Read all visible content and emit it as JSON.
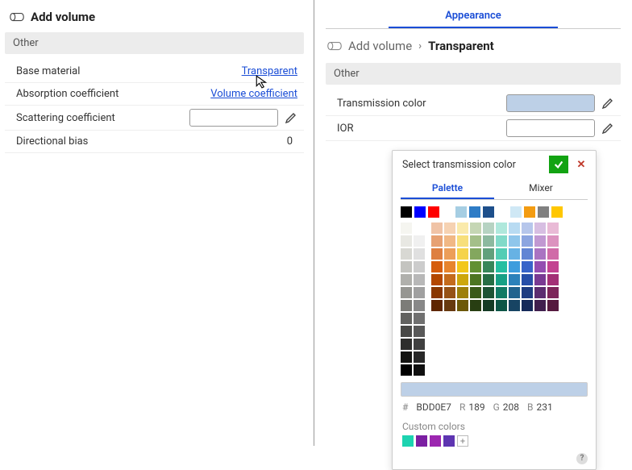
{
  "left": {
    "title": "Add volume",
    "section": "Other",
    "rows": [
      {
        "label": "Base material",
        "value": "Transparent"
      },
      {
        "label": "Absorption coefficient",
        "value": "Volume coefficient"
      },
      {
        "label": "Scattering coefficient",
        "value": ""
      },
      {
        "label": "Directional bias",
        "value": "0"
      }
    ]
  },
  "right": {
    "topTab": "Appearance",
    "breadcrumb": {
      "parent": "Add volume",
      "current": "Transparent"
    },
    "section": "Other",
    "rows": [
      {
        "label": "Transmission color",
        "styleBg": "background:#BDD0E7"
      },
      {
        "label": "IOR",
        "value": ""
      }
    ]
  },
  "popup": {
    "title": "Select transmission color",
    "closeGlyph": "✕",
    "tabs": [
      "Palette",
      "Mixer"
    ],
    "accentSwatches": [
      "#000000",
      "#0000ff",
      "#ff0000",
      "transparent",
      "#a6cee3",
      "#2e7cc6",
      "#1d4f8b",
      "transparent",
      "#cfe8f5",
      "#f39c12",
      "#808080",
      "#ffc700"
    ],
    "graySwatches": [
      "#f5f5f0",
      "#ffffff",
      "#e8e8e3",
      "#f0f0f0",
      "#d8d8d3",
      "#e0e0e0",
      "#c4c4c0",
      "#cccccc",
      "#b0b0ac",
      "#b8b8b8",
      "#969692",
      "#a0a0a0",
      "#7c7c78",
      "#888888",
      "#626260",
      "#707070",
      "#484846",
      "#585858",
      "#2e2e2c",
      "#404040",
      "#141412",
      "#282828",
      "#000000",
      "#101010"
    ],
    "mainHues": [
      "#d35400",
      "#e67e22",
      "#f1c40f",
      "#5a8a28",
      "#2d8050",
      "#1abc9c",
      "#3498db",
      "#2e5cc6",
      "#8e44ad",
      "#c0398b"
    ],
    "previewStyle": "background:#BDD0E7",
    "hex": "BDD0E7",
    "r": "189",
    "g": "208",
    "b": "231",
    "rLabel": "R",
    "gLabel": "G",
    "bLabel": "B",
    "customLabel": "Custom colors",
    "customSwatches": [
      "#1dd3b0",
      "#7b1fa2",
      "#9c27b0",
      "#5e35b1"
    ]
  }
}
